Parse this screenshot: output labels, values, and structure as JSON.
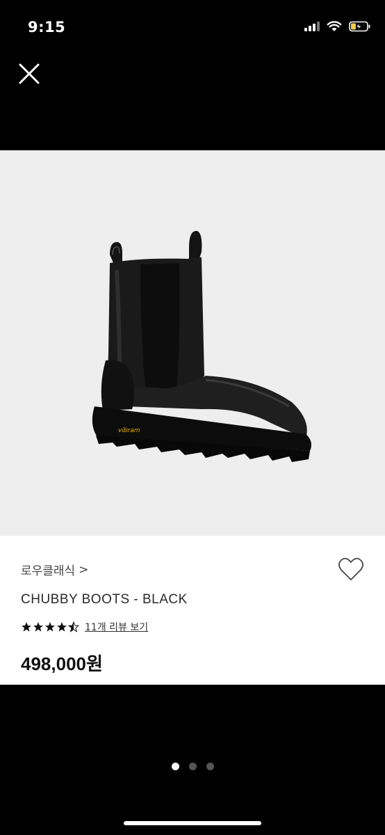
{
  "status_bar": {
    "time": "9:15"
  },
  "product": {
    "brand": "로우클래식",
    "brand_chevron": ">",
    "name": "CHUBBY BOOTS - BLACK",
    "rating": 4.5,
    "review_link": "11개 리뷰 보기",
    "price": "498,000원",
    "sole_logo": "vibram"
  },
  "gallery": {
    "page_count": 3,
    "current_page": 1
  },
  "colors": {
    "background": "#000000",
    "image_bg": "#eeeeee",
    "panel_bg": "#ffffff",
    "text_primary": "#222222",
    "sole_logo": "#e8b400"
  },
  "icons": {
    "close": "close-icon",
    "wishlist": "heart-outline-icon",
    "signal": "cellular-signal-icon",
    "wifi": "wifi-icon",
    "battery": "battery-charging-icon"
  }
}
